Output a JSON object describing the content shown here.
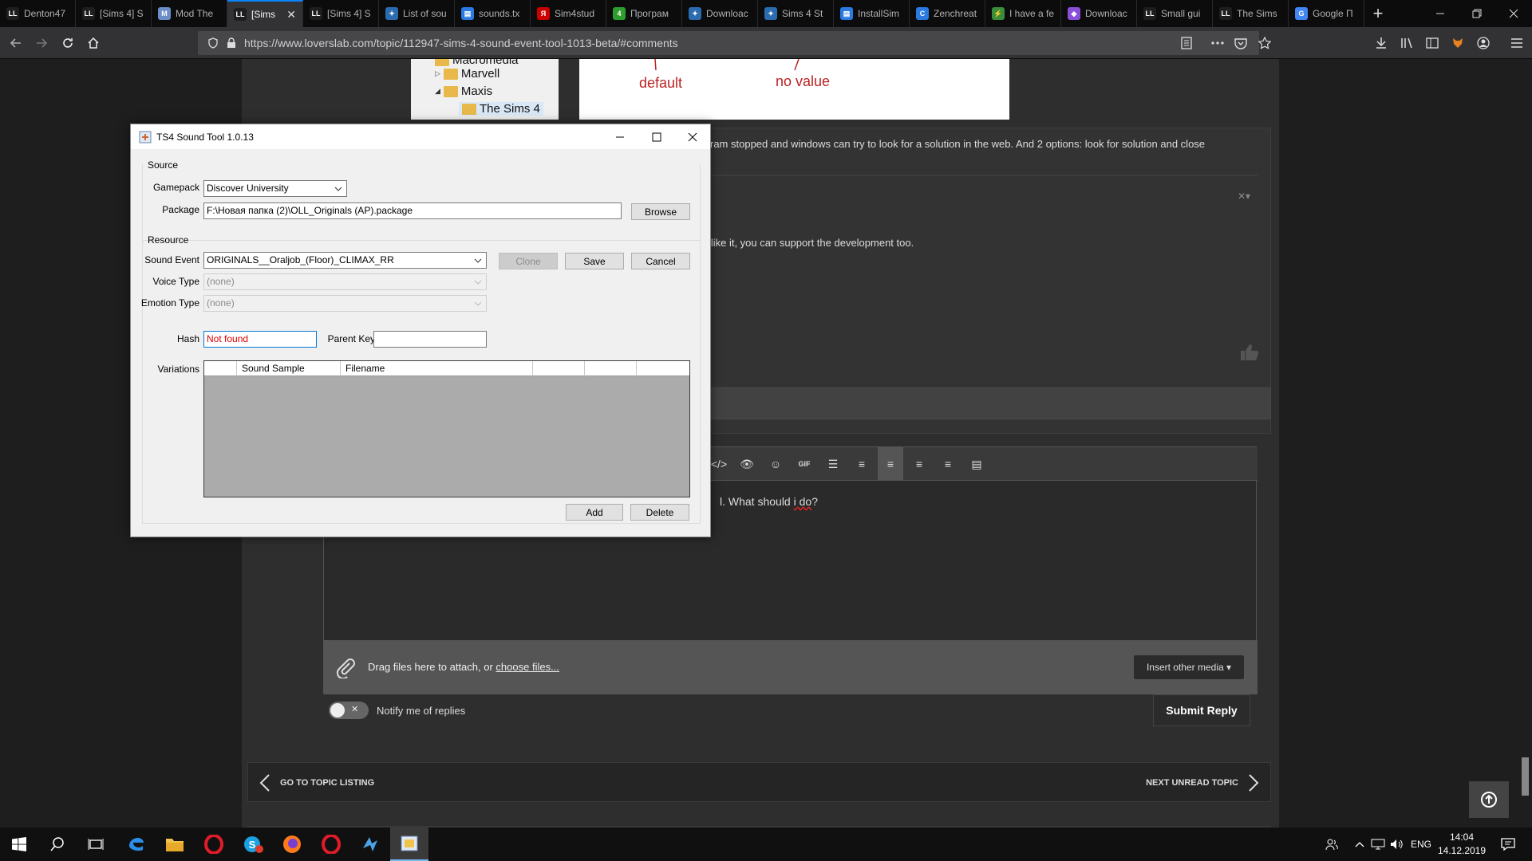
{
  "browser": {
    "tabs": [
      {
        "label": "Denton47",
        "favicon": "LL",
        "color": "#1e1e1e"
      },
      {
        "label": "[Sims 4] S",
        "favicon": "LL",
        "color": "#1e1e1e"
      },
      {
        "label": "Mod The",
        "favicon": "M",
        "color": "#6a8ec8"
      },
      {
        "label": "[Sims",
        "favicon": "LL",
        "color": "#1e1e1e",
        "active": true
      },
      {
        "label": "[Sims 4] S",
        "favicon": "LL",
        "color": "#1e1e1e"
      },
      {
        "label": "List of sou",
        "favicon": "✦",
        "color": "#2b6cb0"
      },
      {
        "label": "sounds.tx",
        "favicon": "▤",
        "color": "#2a7ae2"
      },
      {
        "label": "Sim4stud",
        "favicon": "Я",
        "color": "#c00"
      },
      {
        "label": "Програм",
        "favicon": "4",
        "color": "#2e9d2e"
      },
      {
        "label": "Downloac",
        "favicon": "✦",
        "color": "#2b6cb0"
      },
      {
        "label": "Sims 4 St",
        "favicon": "✦",
        "color": "#2b6cb0"
      },
      {
        "label": "InstallSim",
        "favicon": "▤",
        "color": "#2a7ae2"
      },
      {
        "label": "Zenchreat",
        "favicon": "C",
        "color": "#2a7ae2"
      },
      {
        "label": "I have a fe",
        "favicon": "⚡",
        "color": "#3a8e3a"
      },
      {
        "label": "Downloac",
        "favicon": "◆",
        "color": "#8a4fd8"
      },
      {
        "label": "Small gui",
        "favicon": "LL",
        "color": "#1e1e1e"
      },
      {
        "label": "The Sims",
        "favicon": "LL",
        "color": "#1e1e1e"
      },
      {
        "label": "Google П",
        "favicon": "G",
        "color": "#4285f4"
      }
    ],
    "url": "https://www.loverslab.com/topic/112947-sims-4-sound-event-tool-1013-beta/#comments"
  },
  "page": {
    "tree_items": [
      "Macromedia",
      "Marvell",
      "Maxis",
      "The Sims 4"
    ],
    "sketch_labels": [
      "default",
      "no value"
    ],
    "post_text_1": "ram stopped and windows can try to look for a solution in the web. And 2 options: look for solution and close",
    "post_text_2": "u like it, you can support the development too.",
    "editor_text_plain": "l. What should ",
    "editor_text_spell": "i do",
    "editor_text_end": "?",
    "attach_prefix": "Drag files here to attach, or ",
    "attach_link": "choose files...",
    "insert_media": "Insert other media ▾",
    "notify": "Notify me of replies",
    "submit": "Submit Reply",
    "prev_topic": "GO TO TOPIC LISTING",
    "next_topic": "NEXT UNREAD TOPIC"
  },
  "dialog": {
    "title": "TS4 Sound Tool 1.0.13",
    "source_group": "Source",
    "gamepack_label": "Gamepack",
    "gamepack_value": "Discover University",
    "package_label": "Package",
    "package_value": "F:\\Новая папка (2)\\OLL_Originals (AP).package",
    "browse": "Browse",
    "resource_group": "Resource",
    "sound_event_label": "Sound Event",
    "sound_event_value": "ORIGINALS__Oraljob_(Floor)_CLIMAX_RR",
    "clone": "Clone",
    "save": "Save",
    "cancel": "Cancel",
    "voice_type_label": "Voice Type",
    "voice_type_value": "(none)",
    "emotion_type_label": "Emotion Type",
    "emotion_type_value": "(none)",
    "hash_label": "Hash",
    "hash_value": "Not found",
    "parent_key_label": "Parent Key",
    "parent_key_value": "",
    "variations_label": "Variations",
    "columns": [
      "",
      "Sound Sample",
      "Filename",
      "",
      "",
      ""
    ],
    "add": "Add",
    "delete": "Delete"
  },
  "taskbar": {
    "language": "ENG",
    "time": "14:04",
    "date": "14.12.2019"
  }
}
